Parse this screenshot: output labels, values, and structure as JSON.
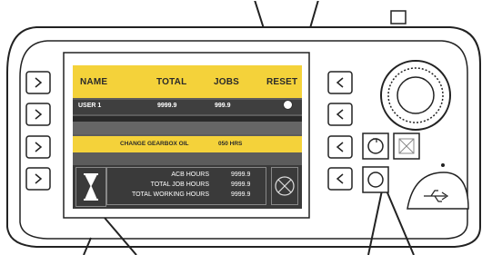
{
  "header": {
    "col_name": "NAME",
    "col_total": "TOTAL",
    "col_jobs": "JOBS",
    "col_reset": "RESET"
  },
  "row": {
    "user": "USER 1",
    "total": "9999.9",
    "jobs": "999.9"
  },
  "alert": {
    "message": "CHANGE GEARBOX OIL",
    "hours": "050 HRS"
  },
  "hours": [
    {
      "label": "ACB HOURS",
      "value": "9999.9"
    },
    {
      "label": "TOTAL JOB HOURS",
      "value": "9999.9"
    },
    {
      "label": "TOTAL WORKING HOURS",
      "value": "9999.9"
    }
  ],
  "colors": {
    "accent": "#f4d23a",
    "screen_bg": "#5c5c5c",
    "device_outline": "#222222"
  },
  "icons": {
    "left_keys": "chevron-right-icon",
    "right_keys": "chevron-left-icon",
    "rotary": "rotary-knob-icon",
    "usb": "usb-icon",
    "reset": "reset-icon",
    "hourglass": "hourglass-icon",
    "noop": "no-operation-icon"
  }
}
